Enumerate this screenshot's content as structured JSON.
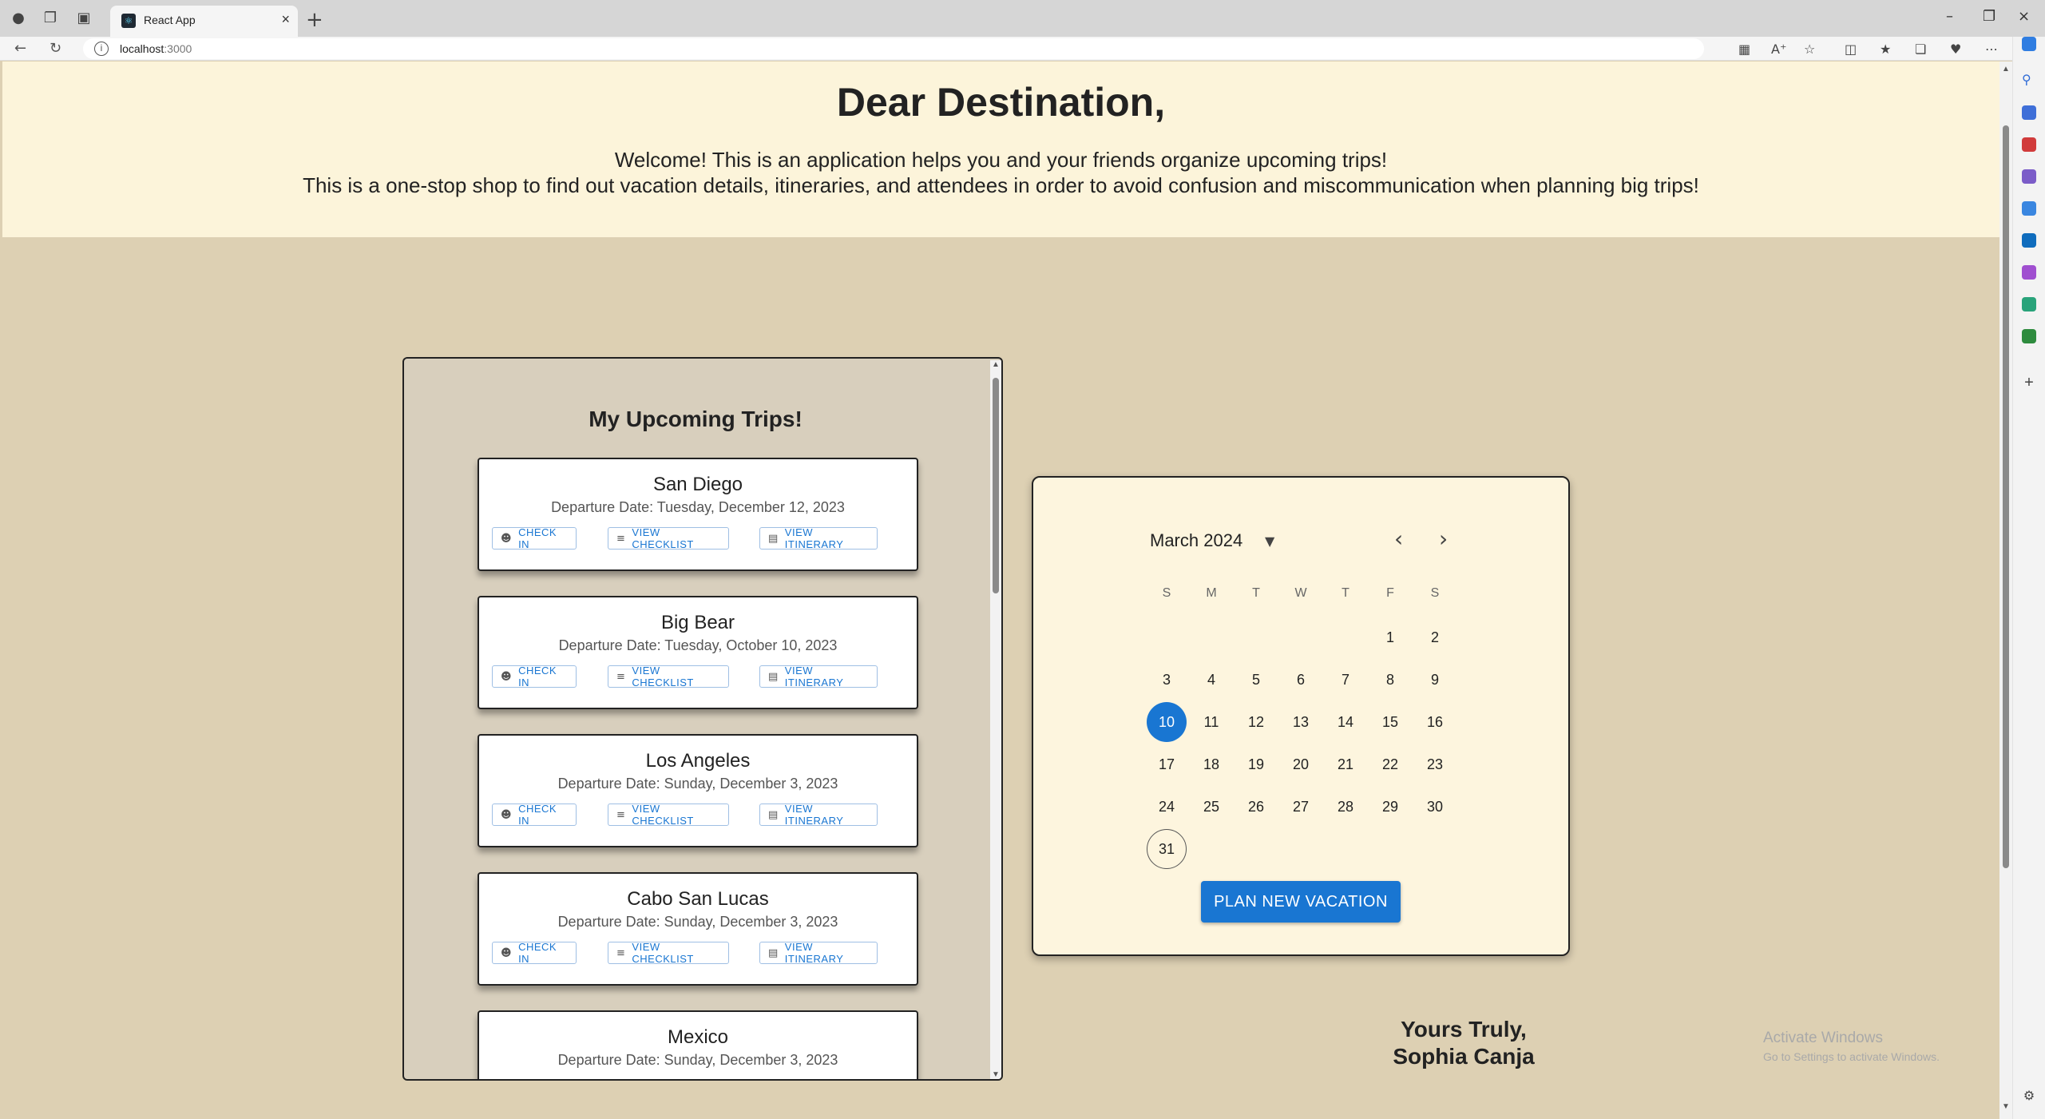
{
  "browser": {
    "tab_title": "React App",
    "url_host": "localhost",
    "url_port": ":3000"
  },
  "header": {
    "title": "Dear Destination,",
    "welcome": "Welcome! This is an application helps you and your friends organize upcoming trips!",
    "description": "This is a one-stop shop to find out vacation details, itineraries, and attendees in order to avoid confusion and miscommunication when planning big trips!"
  },
  "trips": {
    "heading": "My Upcoming Trips!",
    "buttons": {
      "check_in": "CHECK IN",
      "checklist": "VIEW CHECKLIST",
      "itinerary": "VIEW ITINERARY"
    },
    "items": [
      {
        "city": "San Diego",
        "date": "Departure Date: Tuesday, December 12, 2023"
      },
      {
        "city": "Big Bear",
        "date": "Departure Date: Tuesday, October 10, 2023"
      },
      {
        "city": "Los Angeles",
        "date": "Departure Date: Sunday, December 3, 2023"
      },
      {
        "city": "Cabo San Lucas",
        "date": "Departure Date: Sunday, December 3, 2023"
      },
      {
        "city": "Mexico",
        "date": "Departure Date: Sunday, December 3, 2023"
      }
    ]
  },
  "calendar": {
    "month_label": "March 2024",
    "weekdays": [
      "S",
      "M",
      "T",
      "W",
      "T",
      "F",
      "S"
    ],
    "first_weekday_index": 5,
    "days_in_month": 31,
    "selected_day": 10,
    "today_day": 31,
    "plan_button": "PLAN NEW VACATION",
    "accent_color": "#1976d2"
  },
  "signoff": {
    "line1": "Yours Truly,",
    "line2": "Sophia Canja"
  },
  "watermark": {
    "line1": "Activate Windows",
    "line2": "Go to Settings to activate Windows."
  }
}
